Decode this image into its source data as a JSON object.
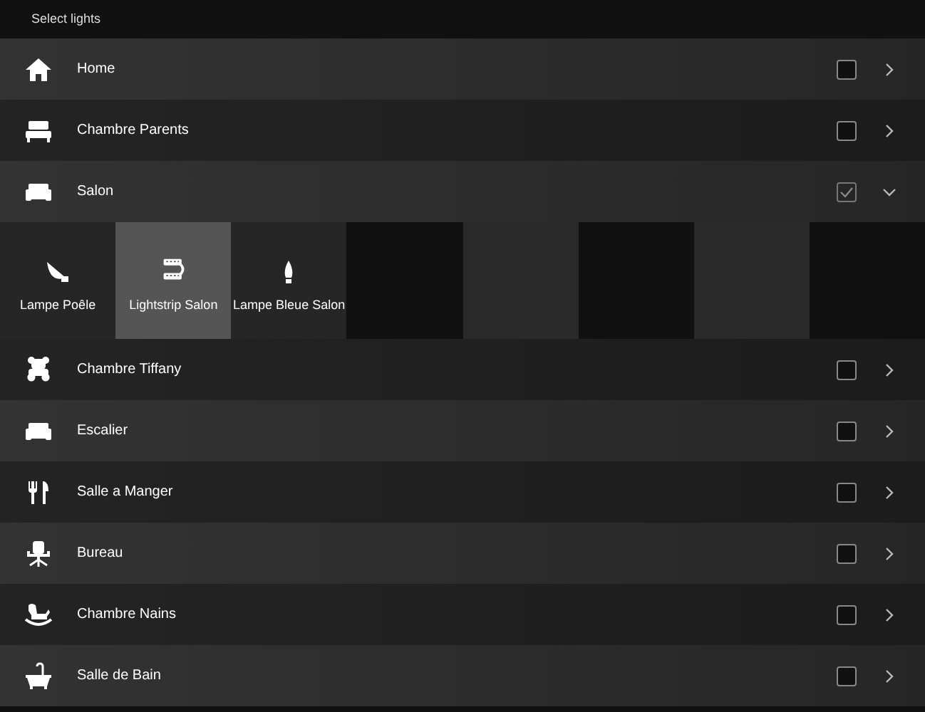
{
  "header": {
    "title": "Select lights"
  },
  "rooms": [
    {
      "name": "Home",
      "kind": "home",
      "checked": false,
      "expanded": false
    },
    {
      "name": "Chambre Parents",
      "kind": "bed",
      "checked": false,
      "expanded": false
    },
    {
      "name": "Salon",
      "kind": "sofa",
      "checked": true,
      "expanded": true,
      "lights": [
        {
          "name": "Lampe Poêle",
          "kind": "bloom",
          "selected": false
        },
        {
          "name": "Lightstrip Salon",
          "kind": "strip",
          "selected": true
        },
        {
          "name": "Lampe Bleue Salon",
          "kind": "candle",
          "selected": false
        }
      ]
    },
    {
      "name": "Chambre Tiffany",
      "kind": "teddy",
      "checked": false,
      "expanded": false
    },
    {
      "name": "Escalier",
      "kind": "sofa",
      "checked": false,
      "expanded": false
    },
    {
      "name": "Salle a Manger",
      "kind": "cutlery",
      "checked": false,
      "expanded": false
    },
    {
      "name": "Bureau",
      "kind": "chair",
      "checked": false,
      "expanded": false
    },
    {
      "name": "Chambre Nains",
      "kind": "horse",
      "checked": false,
      "expanded": false
    },
    {
      "name": "Salle de Bain",
      "kind": "bath",
      "checked": false,
      "expanded": false
    }
  ]
}
